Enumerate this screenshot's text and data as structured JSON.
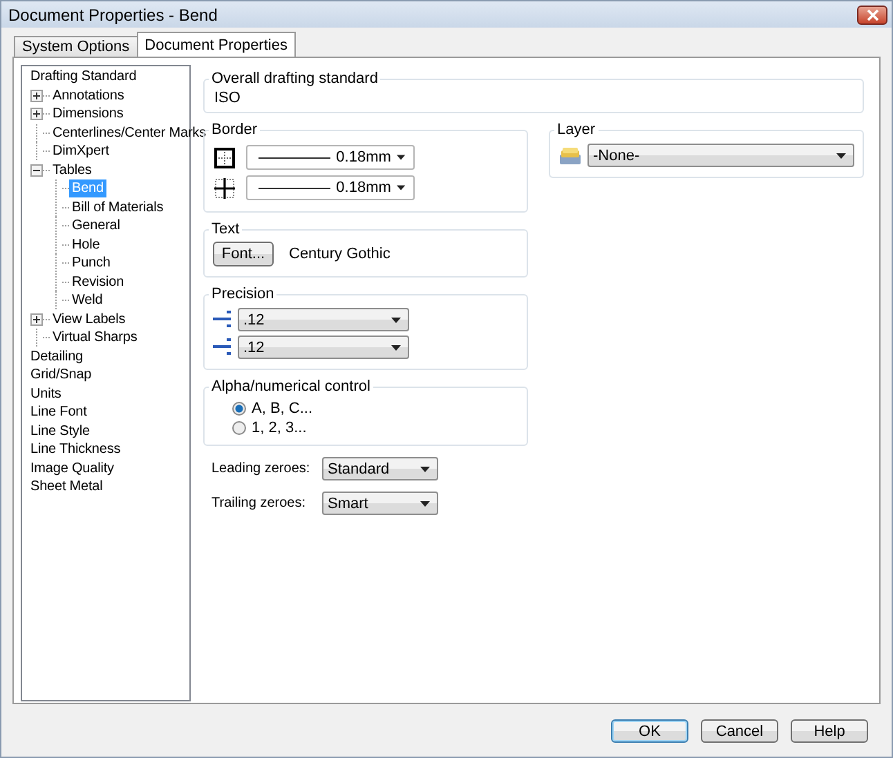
{
  "window": {
    "title": "Document Properties - Bend"
  },
  "tabs": [
    {
      "label": "System Options",
      "selected": false
    },
    {
      "label": "Document Properties",
      "selected": true
    }
  ],
  "tree": [
    {
      "label": "Drafting Standard",
      "selected": false,
      "children": [
        {
          "label": "Annotations",
          "selected": false,
          "expanded": false
        },
        {
          "label": "Dimensions",
          "selected": false,
          "expanded": false
        },
        {
          "label": "Centerlines/Center Marks",
          "selected": false
        },
        {
          "label": "DimXpert",
          "selected": false
        },
        {
          "label": "Tables",
          "selected": false,
          "expanded": true,
          "children": [
            {
              "label": "Bend",
              "selected": true
            },
            {
              "label": "Bill of Materials",
              "selected": false
            },
            {
              "label": "General",
              "selected": false
            },
            {
              "label": "Hole",
              "selected": false
            },
            {
              "label": "Punch",
              "selected": false
            },
            {
              "label": "Revision",
              "selected": false
            },
            {
              "label": "Weld",
              "selected": false
            }
          ]
        },
        {
          "label": "View Labels",
          "selected": false,
          "expanded": false
        },
        {
          "label": "Virtual Sharps",
          "selected": false
        }
      ]
    },
    {
      "label": "Detailing",
      "selected": false
    },
    {
      "label": "Grid/Snap",
      "selected": false
    },
    {
      "label": "Units",
      "selected": false
    },
    {
      "label": "Line Font",
      "selected": false
    },
    {
      "label": "Line Style",
      "selected": false
    },
    {
      "label": "Line Thickness",
      "selected": false
    },
    {
      "label": "Image Quality",
      "selected": false
    },
    {
      "label": "Sheet Metal",
      "selected": false
    }
  ],
  "overall_standard": {
    "title": "Overall drafting standard",
    "value": "ISO"
  },
  "border": {
    "title": "Border",
    "rows": [
      {
        "kind": "outer",
        "value": "0.18mm"
      },
      {
        "kind": "inner",
        "value": "0.18mm"
      }
    ]
  },
  "text": {
    "title": "Text",
    "button": "Font...",
    "font": "Century Gothic"
  },
  "precision": {
    "title": "Precision",
    "rows": [
      ".12",
      ".12"
    ]
  },
  "alpha": {
    "title": "Alpha/numerical control",
    "options": [
      {
        "label": "A, B, C...",
        "selected": true
      },
      {
        "label": "1, 2, 3...",
        "selected": false
      }
    ]
  },
  "zeroes": [
    {
      "label": "Leading zeroes:",
      "value": "Standard"
    },
    {
      "label": "Trailing zeroes:",
      "value": "Smart"
    }
  ],
  "layer": {
    "title": "Layer",
    "value": "-None-"
  },
  "buttons": [
    {
      "label": "OK",
      "default": true
    },
    {
      "label": "Cancel",
      "default": false
    },
    {
      "label": "Help",
      "default": false
    }
  ]
}
